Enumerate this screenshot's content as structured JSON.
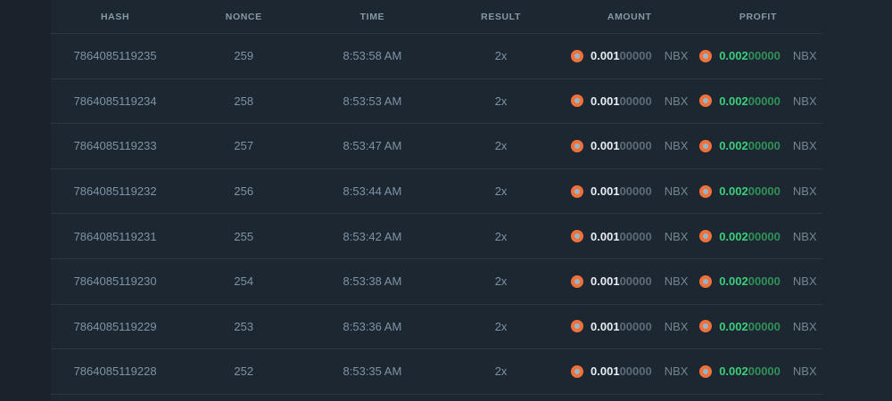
{
  "table": {
    "columns": [
      "HASH",
      "NONCE",
      "TIME",
      "RESULT",
      "AMOUNT",
      "PROFIT"
    ],
    "currency": "NBX",
    "rows": [
      {
        "hash": "7864085119235",
        "nonce": "259",
        "time": "8:53:58 AM",
        "result": "2x",
        "amount_main": "0.001",
        "amount_dim": "00000",
        "amount_currency": "NBX",
        "profit_main": "0.002",
        "profit_dim": "00000",
        "profit_currency": "NBX"
      },
      {
        "hash": "7864085119234",
        "nonce": "258",
        "time": "8:53:53 AM",
        "result": "2x",
        "amount_main": "0.001",
        "amount_dim": "00000",
        "amount_currency": "NBX",
        "profit_main": "0.002",
        "profit_dim": "00000",
        "profit_currency": "NBX"
      },
      {
        "hash": "7864085119233",
        "nonce": "257",
        "time": "8:53:47 AM",
        "result": "2x",
        "amount_main": "0.001",
        "amount_dim": "00000",
        "amount_currency": "NBX",
        "profit_main": "0.002",
        "profit_dim": "00000",
        "profit_currency": "NBX"
      },
      {
        "hash": "7864085119232",
        "nonce": "256",
        "time": "8:53:44 AM",
        "result": "2x",
        "amount_main": "0.001",
        "amount_dim": "00000",
        "amount_currency": "NBX",
        "profit_main": "0.002",
        "profit_dim": "00000",
        "profit_currency": "NBX"
      },
      {
        "hash": "7864085119231",
        "nonce": "255",
        "time": "8:53:42 AM",
        "result": "2x",
        "amount_main": "0.001",
        "amount_dim": "00000",
        "amount_currency": "NBX",
        "profit_main": "0.002",
        "profit_dim": "00000",
        "profit_currency": "NBX"
      },
      {
        "hash": "7864085119230",
        "nonce": "254",
        "time": "8:53:38 AM",
        "result": "2x",
        "amount_main": "0.001",
        "amount_dim": "00000",
        "amount_currency": "NBX",
        "profit_main": "0.002",
        "profit_dim": "00000",
        "profit_currency": "NBX"
      },
      {
        "hash": "7864085119229",
        "nonce": "253",
        "time": "8:53:36 AM",
        "result": "2x",
        "amount_main": "0.001",
        "amount_dim": "00000",
        "amount_currency": "NBX",
        "profit_main": "0.002",
        "profit_dim": "00000",
        "profit_currency": "NBX"
      },
      {
        "hash": "7864085119228",
        "nonce": "252",
        "time": "8:53:35 AM",
        "result": "2x",
        "amount_main": "0.001",
        "amount_dim": "00000",
        "amount_currency": "NBX",
        "profit_main": "0.002",
        "profit_dim": "00000",
        "profit_currency": "NBX"
      }
    ]
  },
  "colors": {
    "page_background": "#1a222c",
    "panel_background": "#1d2732",
    "divider": "#2b3743",
    "header_text": "#8699a8",
    "cell_text": "#7e93a4",
    "amount_main": "#e7edf2",
    "amount_dim": "#5d6c78",
    "profit_main": "#3bcf7c",
    "profit_dim": "#2f9158",
    "currency_text": "#75858f",
    "coin_ring": "#f2713b",
    "coin_center": "#93b7ca"
  }
}
